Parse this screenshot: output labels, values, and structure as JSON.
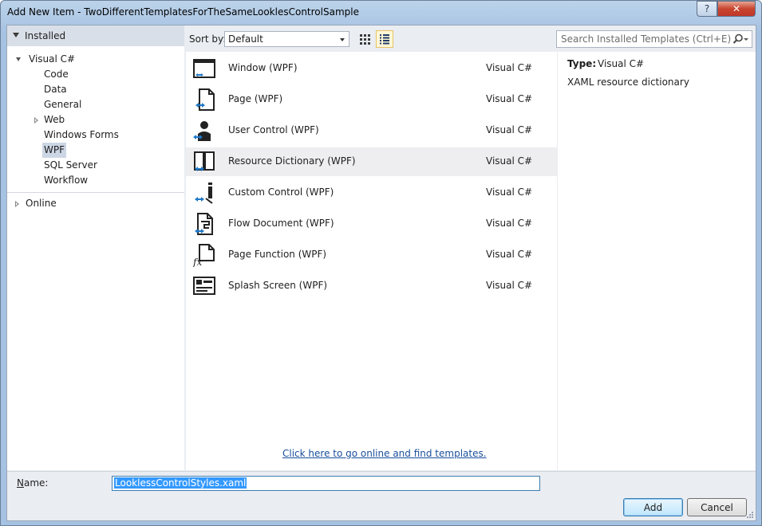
{
  "window": {
    "title": "Add New Item - TwoDifferentTemplatesForTheSameLooklesControlSample",
    "help_glyph": "?",
    "close_glyph": "✕"
  },
  "sidebar": {
    "installed_label": "Installed",
    "tree": [
      {
        "label": "Visual C#"
      },
      {
        "label": "Code"
      },
      {
        "label": "Data"
      },
      {
        "label": "General"
      },
      {
        "label": "Web"
      },
      {
        "label": "Windows Forms"
      },
      {
        "label": "WPF",
        "selected": true
      },
      {
        "label": "SQL Server"
      },
      {
        "label": "Workflow"
      }
    ],
    "online_label": "Online"
  },
  "toolbar": {
    "sort_label": "Sort by:",
    "sort_value": "Default",
    "search_placeholder": "Search Installed Templates (Ctrl+E)"
  },
  "templates": [
    {
      "name": "Window (WPF)",
      "language": "Visual C#",
      "icon": "window-icon"
    },
    {
      "name": "Page (WPF)",
      "language": "Visual C#",
      "icon": "page-icon"
    },
    {
      "name": "User Control (WPF)",
      "language": "Visual C#",
      "icon": "user-control-icon"
    },
    {
      "name": "Resource Dictionary (WPF)",
      "language": "Visual C#",
      "icon": "resource-dictionary-icon",
      "highlighted": true
    },
    {
      "name": "Custom Control (WPF)",
      "language": "Visual C#",
      "icon": "custom-control-icon"
    },
    {
      "name": "Flow Document (WPF)",
      "language": "Visual C#",
      "icon": "flow-document-icon"
    },
    {
      "name": "Page Function (WPF)",
      "language": "Visual C#",
      "icon": "page-function-icon"
    },
    {
      "name": "Splash Screen (WPF)",
      "language": "Visual C#",
      "icon": "splash-screen-icon"
    }
  ],
  "online_link": "Click here to go online and find templates.",
  "details": {
    "type_label": "Type:",
    "type_value": "Visual C#",
    "description": "XAML resource dictionary"
  },
  "name_field": {
    "label": "Name:",
    "value": "LooklessControlStyles.xaml"
  },
  "buttons": {
    "add": "Add",
    "cancel": "Cancel"
  },
  "colors": {
    "accent_blue": "#3399ff",
    "link": "#1a4f9c",
    "close_red": "#c8452f"
  }
}
